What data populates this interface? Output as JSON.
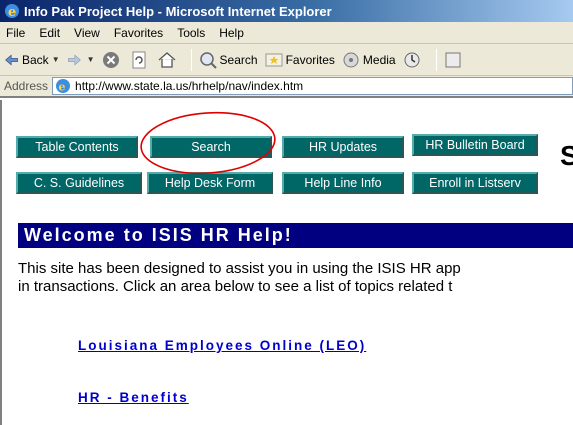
{
  "window": {
    "title": "Info Pak Project Help - Microsoft Internet Explorer"
  },
  "menu": [
    "File",
    "Edit",
    "View",
    "Favorites",
    "Tools",
    "Help"
  ],
  "toolbar": {
    "back": "Back",
    "search": "Search",
    "favorites": "Favorites",
    "media": "Media"
  },
  "address": {
    "label": "Address",
    "url": "http://www.state.la.us/hrhelp/nav/index.htm"
  },
  "nav": {
    "row1": [
      "Table Contents",
      "Search",
      "HR Updates",
      "HR Bulletin Board"
    ],
    "row2": [
      "C. S. Guidelines",
      "Help Desk Form",
      "Help Line Info",
      "Enroll in Listserv"
    ]
  },
  "page": {
    "big_letter": "S",
    "welcome": "Welcome to ISIS HR Help!",
    "intro_line1": "This site has been designed to assist you in using the ISIS HR app",
    "intro_line2": "in transactions. Click an area below to see a list of topics related t",
    "links": [
      "Louisiana Employees Online (LEO)",
      "HR - Benefits"
    ]
  },
  "colors": {
    "nav_button": "#006666",
    "welcome_bar": "#000080",
    "link": "#0000cc",
    "annotation": "#dd0000"
  }
}
